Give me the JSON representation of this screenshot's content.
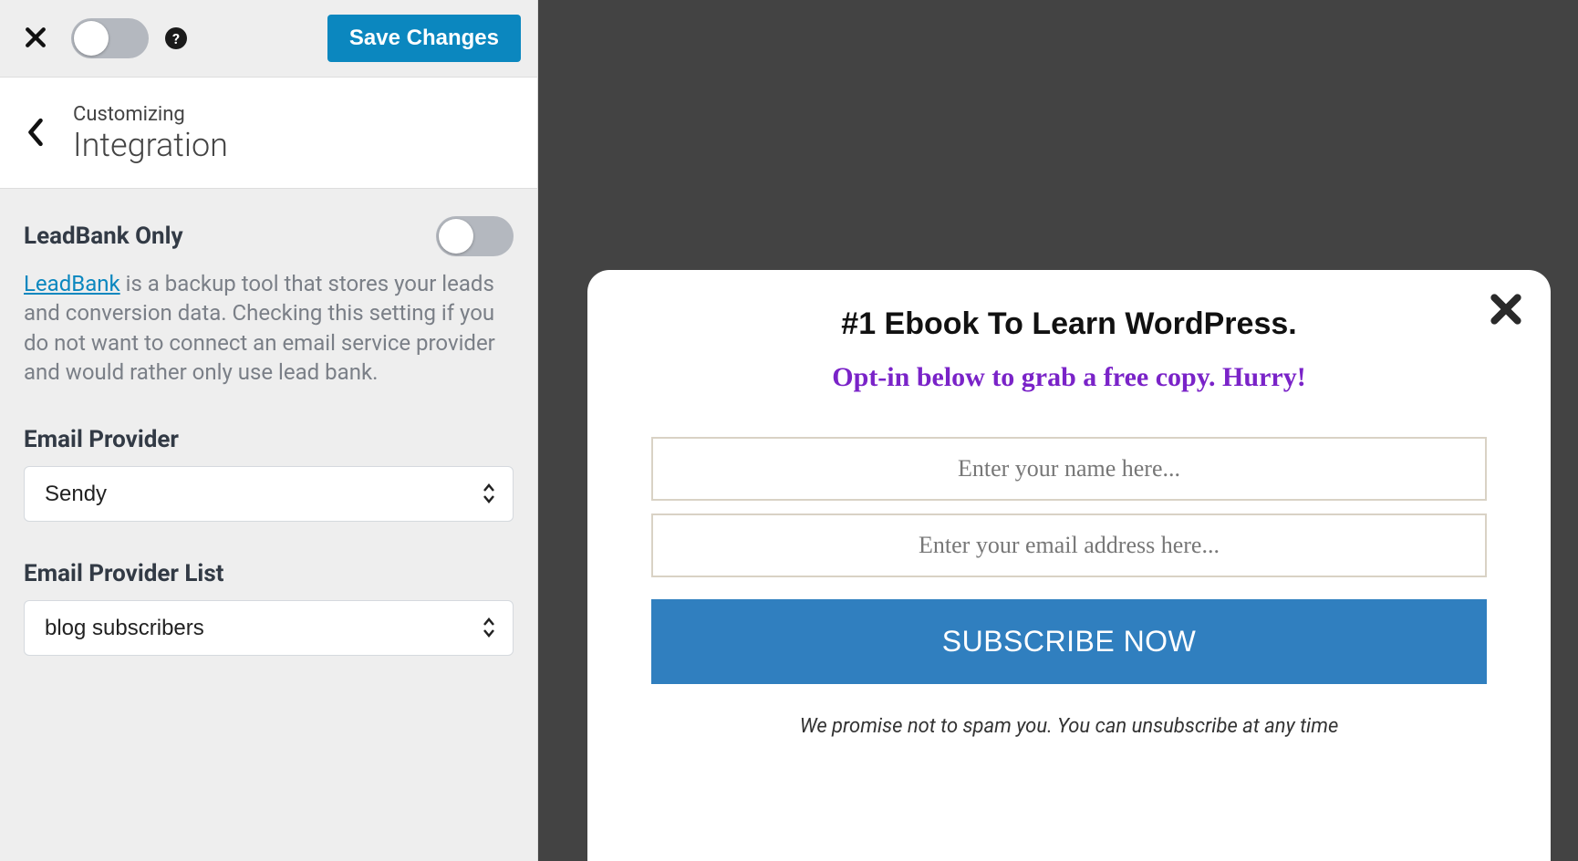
{
  "topbar": {
    "save_label": "Save Changes"
  },
  "panel": {
    "label": "Customizing",
    "title": "Integration"
  },
  "leadbank": {
    "heading": "LeadBank Only",
    "link_text": "LeadBank",
    "desc_rest": " is a backup tool that stores your leads and conversion data. Checking this setting if you do not want to connect an email service provider and would rather only use lead bank."
  },
  "provider": {
    "label": "Email Provider",
    "value": "Sendy"
  },
  "provider_list": {
    "label": "Email Provider List",
    "value": "blog subscribers"
  },
  "modal": {
    "title": "#1 Ebook To Learn WordPress.",
    "subtitle": "Opt-in below to grab a free copy. Hurry!",
    "name_placeholder": "Enter your name here...",
    "email_placeholder": "Enter your email address here...",
    "cta": "SUBSCRIBE NOW",
    "note": "We promise not to spam you. You can unsubscribe at any time"
  }
}
